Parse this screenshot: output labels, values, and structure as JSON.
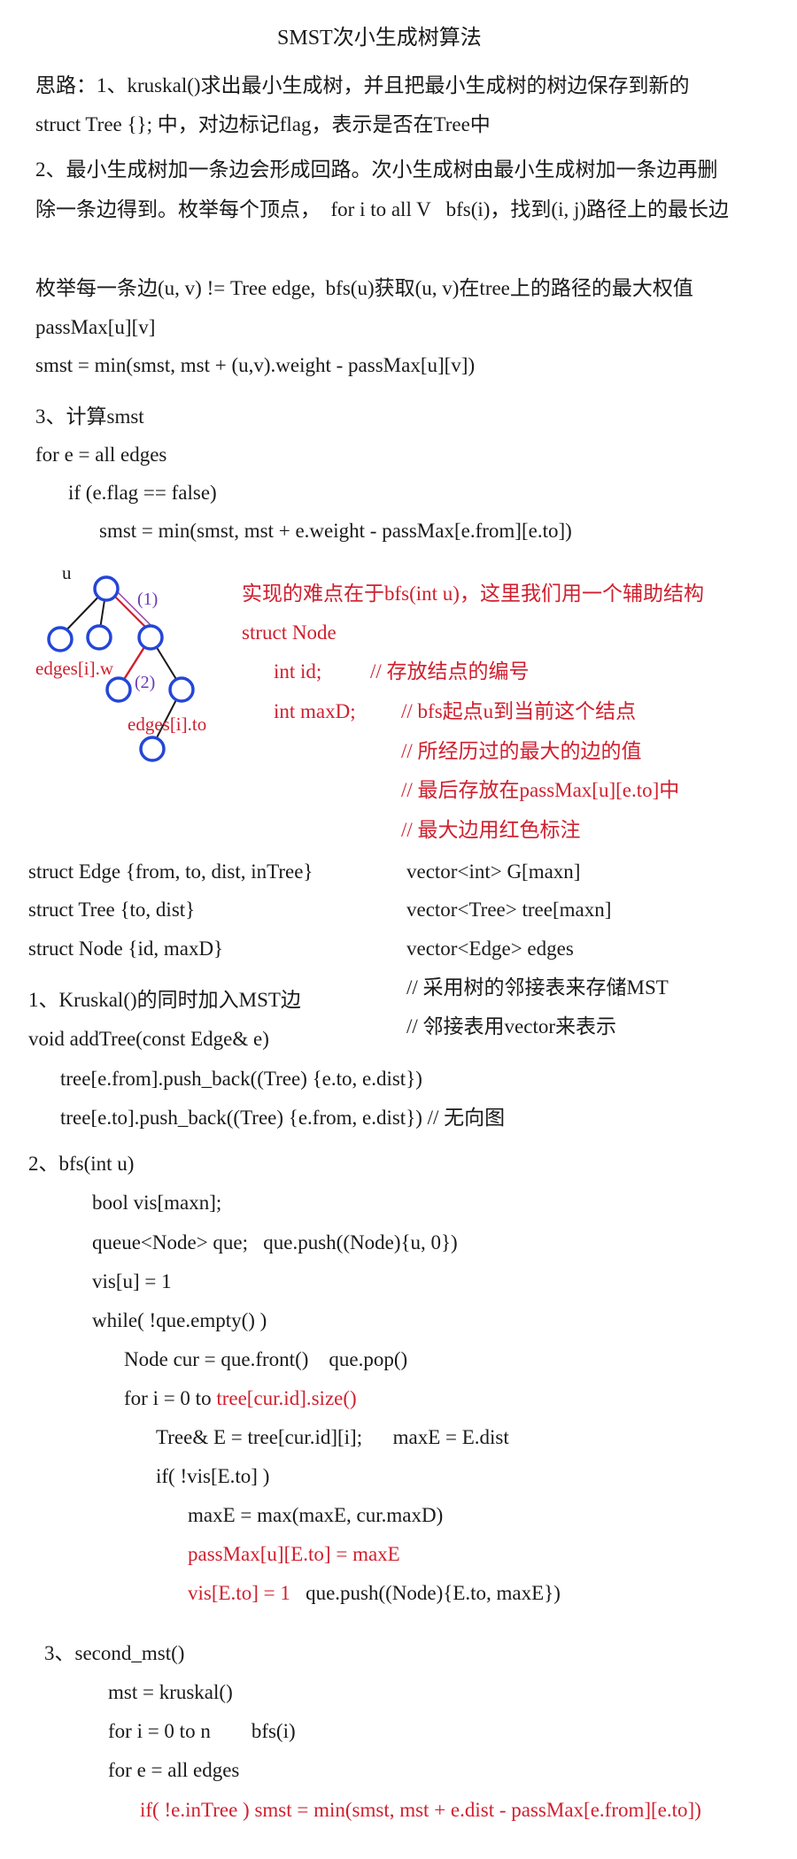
{
  "title": "SMST次小生成树算法",
  "intro": {
    "p1a": "思路：1、kruskal()求出最小生成树，并且把最小生成树的树边保存到新的",
    "p1b": "struct Tree {}; 中，对边标记flag，表示是否在Tree中",
    "p2a": "2、最小生成树加一条边会形成回路。次小生成树由最小生成树加一条边再删",
    "p2b": "除一条边得到。枚举每个顶点，  for i to all V   bfs(i)，找到(i, j)路径上的最长边",
    "p3a": "枚举每一条边(u, v) != Tree edge,  bfs(u)获取(u, v)在tree上的路径的最大权值",
    "p3b": "passMax[u][v]",
    "p3c": "smst = min(smst, mst + (u,v).weight - passMax[u][v])",
    "s3": "3、计算smst",
    "s3a": "for e = all edges",
    "s3b": "if (e.flag == false)",
    "s3c": "smst = min(smst, mst + e.weight - passMax[e.from][e.to])"
  },
  "diagram": {
    "label_u": "u",
    "label_1": "(1)",
    "label_2": "(2)",
    "label_w": "edges[i].w",
    "label_to": "edges[i].to"
  },
  "note": {
    "n1": "实现的难点在于bfs(int u)，这里我们用一个辅助结构",
    "n2": "struct Node",
    "n3a": "int id;",
    "n3b": "// 存放结点的编号",
    "n4a": "int maxD;",
    "n4b": "// bfs起点u到当前这个结点",
    "n5": "// 所经历过的最大的边的值",
    "n6": "// 最后存放在passMax[u][e.to]中",
    "n7": "// 最大边用红色标注"
  },
  "structs": {
    "s1": "struct Edge {from, to, dist, inTree}",
    "s2": "struct Tree {to, dist}",
    "s3": "struct Node {id, maxD}",
    "v1": "vector<int> G[maxn]",
    "v2": "vector<Tree> tree[maxn]",
    "v3": "vector<Edge> edges",
    "c1": "// 采用树的邻接表来存储MST",
    "c2": "// 邻接表用vector来表示"
  },
  "code1": {
    "h": "1、Kruskal()的同时加入MST边",
    "l1": "void addTree(const Edge& e)",
    "l2": "tree[e.from].push_back((Tree) {e.to, e.dist})",
    "l3": "tree[e.to].push_back((Tree) {e.from, e.dist}) // 无向图"
  },
  "code2": {
    "h": "2、bfs(int u)",
    "l1": "bool vis[maxn];",
    "l2": "queue<Node> que;   que.push((Node){u, 0})",
    "l3": "vis[u] = 1",
    "l4": "while( !que.empty() )",
    "l5": "Node cur = que.front()    que.pop()",
    "l6a": "for i = 0 to ",
    "l6b": "tree[cur.id].size()",
    "l7": "Tree& E = tree[cur.id][i];      maxE = E.dist",
    "l8": "if( !vis[E.to] )",
    "l9": "maxE = max(maxE, cur.maxD)",
    "l10": "passMax[u][E.to] = maxE",
    "l11a": "vis[E.to] = 1",
    "l11b": "que.push((Node){E.to, maxE})"
  },
  "code3": {
    "h": "3、second_mst()",
    "l1": "mst = kruskal()",
    "l2": "for i = 0 to n        bfs(i)",
    "l3": "for e = all edges",
    "l4": "if( !e.inTree ) smst = min(smst, mst + e.dist - passMax[e.from][e.to])"
  },
  "colors": {
    "red": "#d01f2e",
    "node_blue": "#2446d8",
    "black": "#1a1a1a"
  }
}
